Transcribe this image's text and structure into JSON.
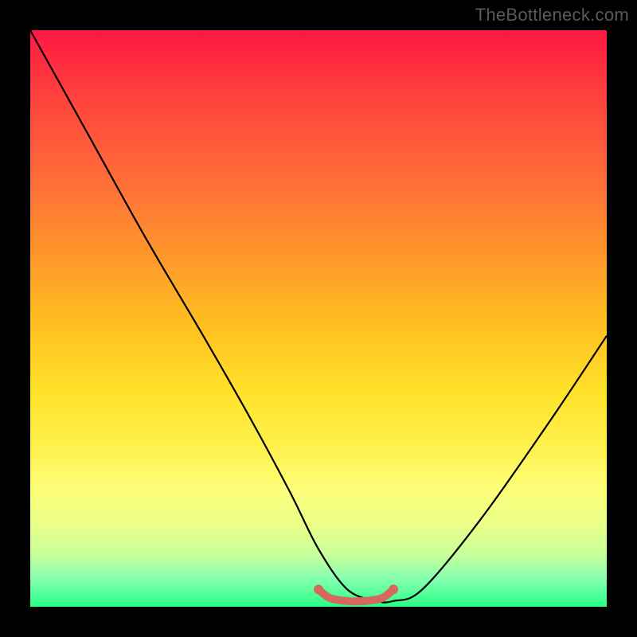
{
  "watermark": "TheBottleneck.com",
  "chart_data": {
    "type": "line",
    "title": "",
    "xlabel": "",
    "ylabel": "",
    "xlim": [
      0,
      100
    ],
    "ylim": [
      0,
      100
    ],
    "grid": false,
    "series": [
      {
        "name": "main-curve",
        "color": "#000000",
        "x": [
          0,
          10,
          20,
          30,
          38,
          45,
          50,
          55,
          60,
          63,
          68,
          78,
          90,
          100
        ],
        "values": [
          100,
          82,
          64,
          47,
          33,
          20,
          10,
          3,
          1,
          1,
          3,
          15,
          32,
          47
        ]
      },
      {
        "name": "flat-segment",
        "color": "#d6695f",
        "x": [
          50,
          52,
          55,
          58,
          61,
          63
        ],
        "values": [
          3,
          1.5,
          1,
          1,
          1.5,
          3
        ]
      }
    ],
    "background_gradient": {
      "type": "vertical",
      "stops": [
        {
          "pos": 0,
          "color": "#ff1744"
        },
        {
          "pos": 25,
          "color": "#ff6a3a"
        },
        {
          "pos": 50,
          "color": "#ffc220"
        },
        {
          "pos": 75,
          "color": "#fff250"
        },
        {
          "pos": 100,
          "color": "#29ff85"
        }
      ]
    }
  }
}
